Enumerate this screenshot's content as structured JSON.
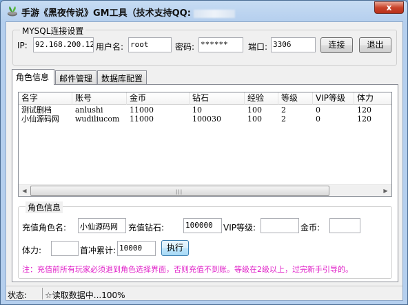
{
  "window": {
    "title": "手游《黑夜传说》GM工具（技术支持QQ:",
    "close_label": "x"
  },
  "mysql": {
    "legend": "MYSQL连接设置",
    "ip_label": "IP:",
    "ip_value": "92.168.200.128",
    "user_label": "用户名:",
    "user_value": "root",
    "password_label": "密码:",
    "password_value": "******",
    "port_label": "端口:",
    "port_value": "3306",
    "connect_label": "连接",
    "exit_label": "退出"
  },
  "tabs": [
    {
      "label": "角色信息"
    },
    {
      "label": "邮件管理"
    },
    {
      "label": "数据库配置"
    }
  ],
  "table": {
    "columns": [
      "名字",
      "账号",
      "金币",
      "钻石",
      "经验",
      "等级",
      "VIP等级",
      "体力"
    ],
    "rows": [
      [
        "测试删档",
        "anlushi",
        "11000",
        "10",
        "100",
        "2",
        "0",
        "120"
      ],
      [
        "小仙源码网",
        "wudiliucom",
        "11000",
        "100030",
        "100",
        "2",
        "0",
        "120"
      ]
    ]
  },
  "role": {
    "legend": "角色信息",
    "name_label": "充值角色名:",
    "name_value": "小仙源码网",
    "diamond_label": "充值钻石:",
    "diamond_value": "100000",
    "vip_label": "VIP等级:",
    "vip_value": "",
    "gold_label": "金币:",
    "gold_value": "",
    "stamina_label": "体力:",
    "stamina_value": "",
    "first_recharge_label": "首冲累计:",
    "first_recharge_value": "10000",
    "execute_label": "执行",
    "note": "注：充值前所有玩家必须退到角色选择界面，否则充值不到账。等级在2级以上，过完新手引导的。"
  },
  "status": {
    "label": "状态:",
    "text": "☆读取数据中...100%"
  },
  "colors": {
    "note": "#e020c8",
    "titlebar": "#b5cfee",
    "close": "#c9442b"
  }
}
